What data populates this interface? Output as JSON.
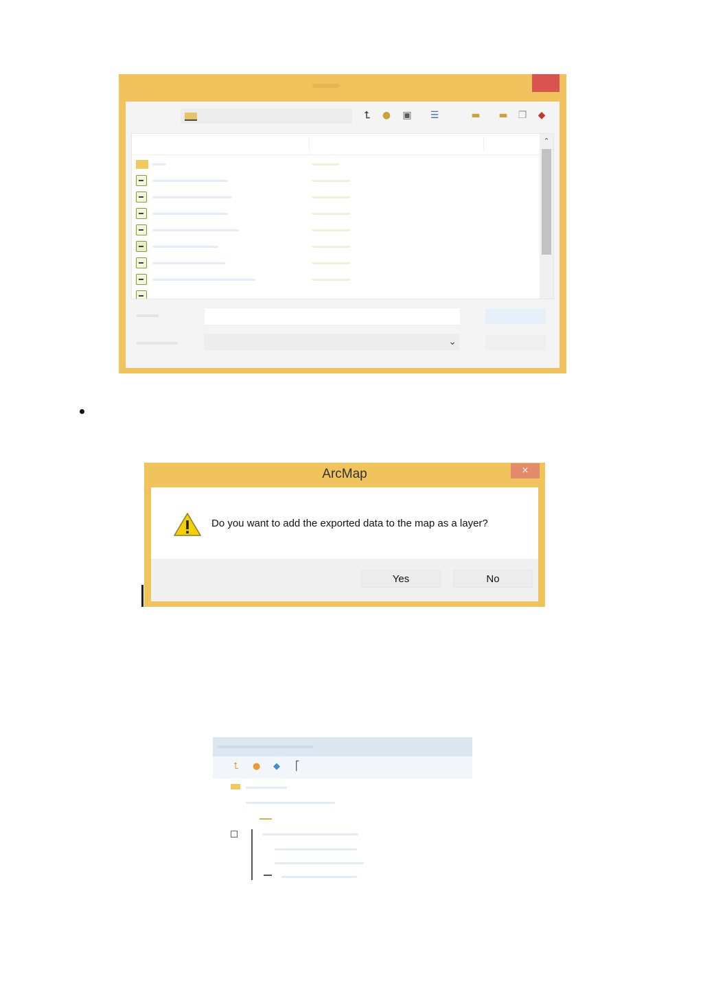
{
  "message_box": {
    "title": "ArcMap",
    "close_glyph": "×",
    "message": "Do you want to add the exported data to the map as a layer?",
    "icon": "warning-icon",
    "yes_label": "Yes",
    "no_label": "No"
  },
  "save_dialog": {
    "icons": [
      "up-one-level-icon",
      "home-icon",
      "connect-folder-icon",
      "view-options-icon",
      "folder-icon",
      "new-folder-icon",
      "copy-icon",
      "toolbox-icon"
    ],
    "scroll_up_glyph": "⌃",
    "type_select_chevron": "⌄",
    "colors": {
      "frame": "#f0c35d",
      "close": "#d9534f"
    }
  },
  "colors": {
    "accent_frame": "#f0c35d",
    "warning": "#f5d000"
  }
}
